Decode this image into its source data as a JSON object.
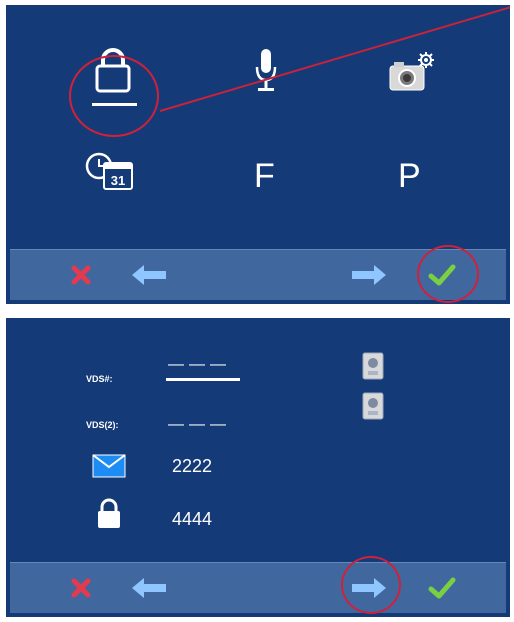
{
  "top_panel": {
    "grid": {
      "row2": {
        "f_label": "F",
        "p_label": "P"
      }
    },
    "colors": {
      "panel_bg": "#143a78",
      "bar_bg": "#41679f",
      "highlight": "#d0213a"
    }
  },
  "bottom_panel": {
    "vds_label": "VDS#:",
    "vds_value": "———",
    "vds2_label": "VDS(2):",
    "vds2_value": "———",
    "mail_code": "2222",
    "lock_code": "4444"
  },
  "icons": {
    "lock": "lock-icon",
    "mic": "microphone-icon",
    "camera_settings": "camera-gear-icon",
    "calendar_clock": "calendar-clock-icon",
    "cancel": "cancel-icon",
    "back": "left-arrow-icon",
    "forward": "right-arrow-icon",
    "confirm": "checkmark-icon",
    "mail": "mail-icon",
    "intercom": "intercom-icon"
  },
  "calendar_day": "31"
}
